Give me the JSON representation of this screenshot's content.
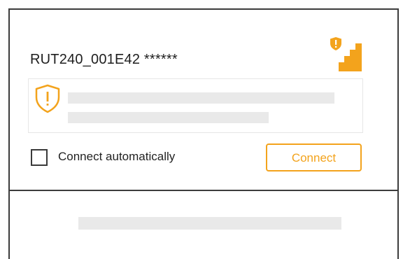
{
  "network": {
    "name": "RUT240_001E42 ******",
    "secured": true,
    "signal_strength": "4/4"
  },
  "warning": {
    "icon": "shield-exclamation-icon"
  },
  "options": {
    "auto_connect_label": "Connect automatically",
    "auto_connect_checked": false
  },
  "actions": {
    "connect_label": "Connect"
  },
  "colors": {
    "accent": "#f3a31c",
    "border": "#3c3c3c",
    "placeholder": "#e9e9e9"
  }
}
